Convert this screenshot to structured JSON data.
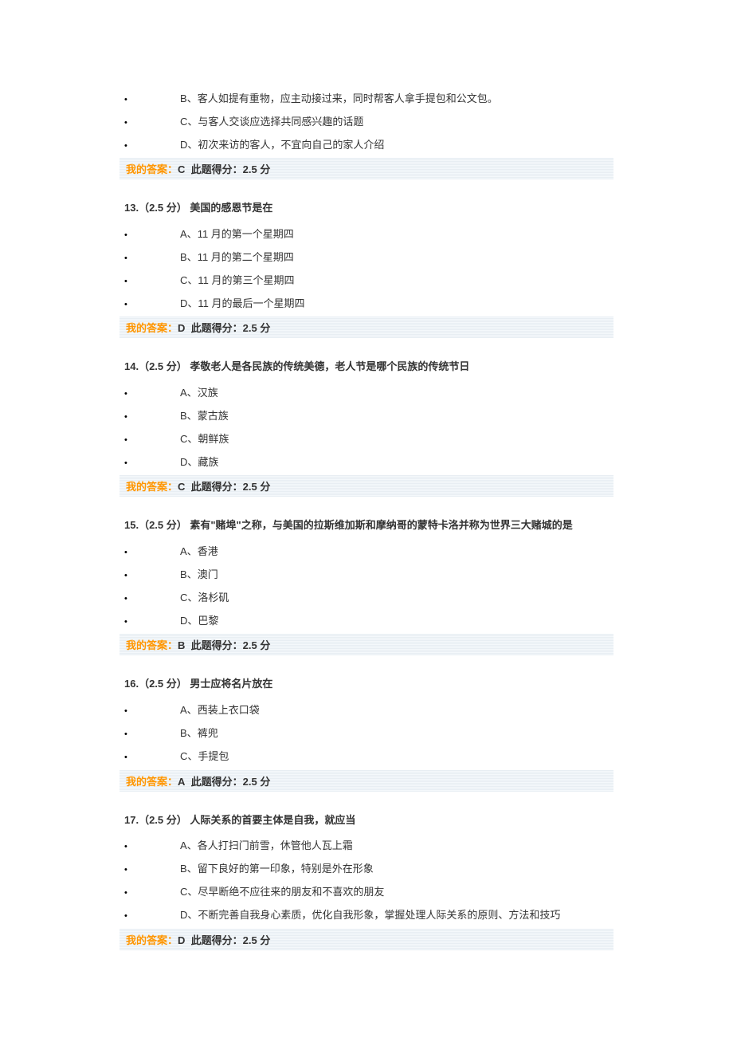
{
  "labels": {
    "my_answer": "我的答案：",
    "score_prefix": "此题得分：",
    "score_suffix": " 分",
    "points_label": "（2.5 分）"
  },
  "partial_question": {
    "options": [
      {
        "letter": "B",
        "text": "客人如提有重物，应主动接过来，同时帮客人拿手提包和公文包。"
      },
      {
        "letter": "C",
        "text": "与客人交谈应选择共同感兴趣的话题"
      },
      {
        "letter": "D",
        "text": "初次来访的客人，不宜向自己的家人介绍"
      }
    ],
    "answer": "C",
    "score": "2.5"
  },
  "questions": [
    {
      "number": "13.",
      "title": "美国的感恩节是在",
      "options": [
        {
          "letter": "A",
          "text": "11 月的第一个星期四"
        },
        {
          "letter": "B",
          "text": "11 月的第二个星期四"
        },
        {
          "letter": "C",
          "text": "11 月的第三个星期四"
        },
        {
          "letter": "D",
          "text": "11 月的最后一个星期四"
        }
      ],
      "answer": "D",
      "score": "2.5"
    },
    {
      "number": "14.",
      "title": "孝敬老人是各民族的传统美德，老人节是哪个民族的传统节日",
      "options": [
        {
          "letter": "A",
          "text": "汉族"
        },
        {
          "letter": "B",
          "text": "蒙古族"
        },
        {
          "letter": "C",
          "text": "朝鲜族"
        },
        {
          "letter": "D",
          "text": "藏族"
        }
      ],
      "answer": "C",
      "score": "2.5"
    },
    {
      "number": "15.",
      "title": "素有\"赌埠\"之称，与美国的拉斯维加斯和摩纳哥的蒙特卡洛并称为世界三大赌城的是",
      "options": [
        {
          "letter": "A",
          "text": "香港"
        },
        {
          "letter": "B",
          "text": "澳门"
        },
        {
          "letter": "C",
          "text": "洛杉矶"
        },
        {
          "letter": "D",
          "text": "巴黎"
        }
      ],
      "answer": "B",
      "score": "2.5"
    },
    {
      "number": "16.",
      "title": "男士应将名片放在",
      "options": [
        {
          "letter": "A",
          "text": "西装上衣口袋"
        },
        {
          "letter": "B",
          "text": "裤兜"
        },
        {
          "letter": "C",
          "text": "手提包"
        }
      ],
      "answer": "A",
      "score": "2.5"
    },
    {
      "number": "17.",
      "title": "人际关系的首要主体是自我，就应当",
      "options": [
        {
          "letter": "A",
          "text": "各人打扫门前雪，休管他人瓦上霜"
        },
        {
          "letter": "B",
          "text": "留下良好的第一印象，特别是外在形象"
        },
        {
          "letter": "C",
          "text": "尽早断绝不应往来的朋友和不喜欢的朋友"
        },
        {
          "letter": "D",
          "text": "不断完善自我身心素质，优化自我形象，掌握处理人际关系的原则、方法和技巧"
        }
      ],
      "answer": "D",
      "score": "2.5"
    }
  ]
}
